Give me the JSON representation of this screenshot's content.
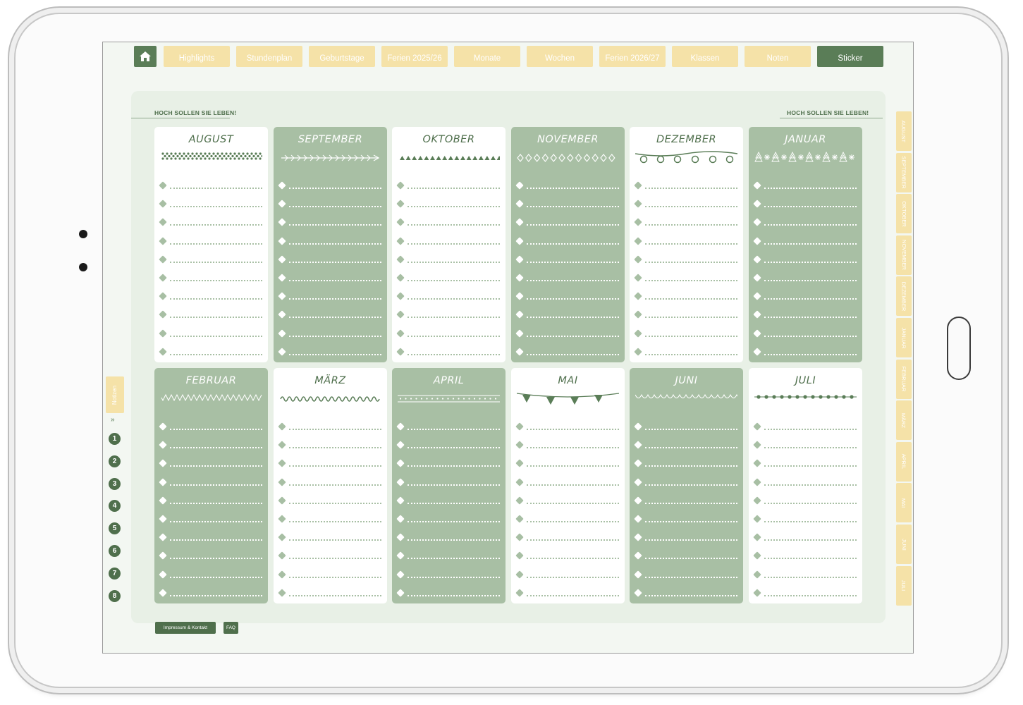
{
  "nav": {
    "tabs": [
      "Highlights",
      "Stundenplan",
      "Geburtstage",
      "Ferien 2025/26",
      "Monate",
      "Wochen",
      "Ferien 2026/27",
      "Klassen",
      "Noten",
      "Sticker"
    ],
    "active_tab": "Sticker"
  },
  "headings": {
    "left": "HOCH SOLLEN SIE LEBEN!",
    "right": "HOCH SOLLEN SIE LEBEN!"
  },
  "months": [
    {
      "name": "AUGUST",
      "style": "white",
      "decoration": "dots-band"
    },
    {
      "name": "SEPTEMBER",
      "style": "green",
      "decoration": "arrow"
    },
    {
      "name": "OKTOBER",
      "style": "white",
      "decoration": "triangles"
    },
    {
      "name": "NOVEMBER",
      "style": "green",
      "decoration": "diamonds"
    },
    {
      "name": "DEZEMBER",
      "style": "white",
      "decoration": "lights"
    },
    {
      "name": "JANUAR",
      "style": "green",
      "decoration": "trees-snow"
    },
    {
      "name": "FEBRUAR",
      "style": "green",
      "decoration": "zigzag"
    },
    {
      "name": "MÄRZ",
      "style": "white",
      "decoration": "wave"
    },
    {
      "name": "APRIL",
      "style": "green",
      "decoration": "dotted-lines"
    },
    {
      "name": "MAI",
      "style": "white",
      "decoration": "bunting"
    },
    {
      "name": "JUNI",
      "style": "green",
      "decoration": "scallops"
    },
    {
      "name": "JULI",
      "style": "white",
      "decoration": "beads"
    }
  ],
  "side_tabs": [
    "AUGUST",
    "SEPTEMBER",
    "OKTOBER",
    "NOVEMBER",
    "DEZEMBER",
    "JANUAR",
    "FEBRUAR",
    "MÄRZ",
    "APRIL",
    "MAI",
    "JUNI",
    "JULI"
  ],
  "notes": {
    "label": "Notizen",
    "chevron": "»",
    "numbers": [
      "1",
      "2",
      "3",
      "4",
      "5",
      "6",
      "7",
      "8"
    ]
  },
  "footer": {
    "impressum": "Impressum & Kontakt",
    "faq": "FAQ"
  },
  "colors": {
    "dark_green": "#5a7d57",
    "sage": "#a8bfa4",
    "pale_yellow": "#f5e2a8",
    "background": "#e8f0e6"
  }
}
